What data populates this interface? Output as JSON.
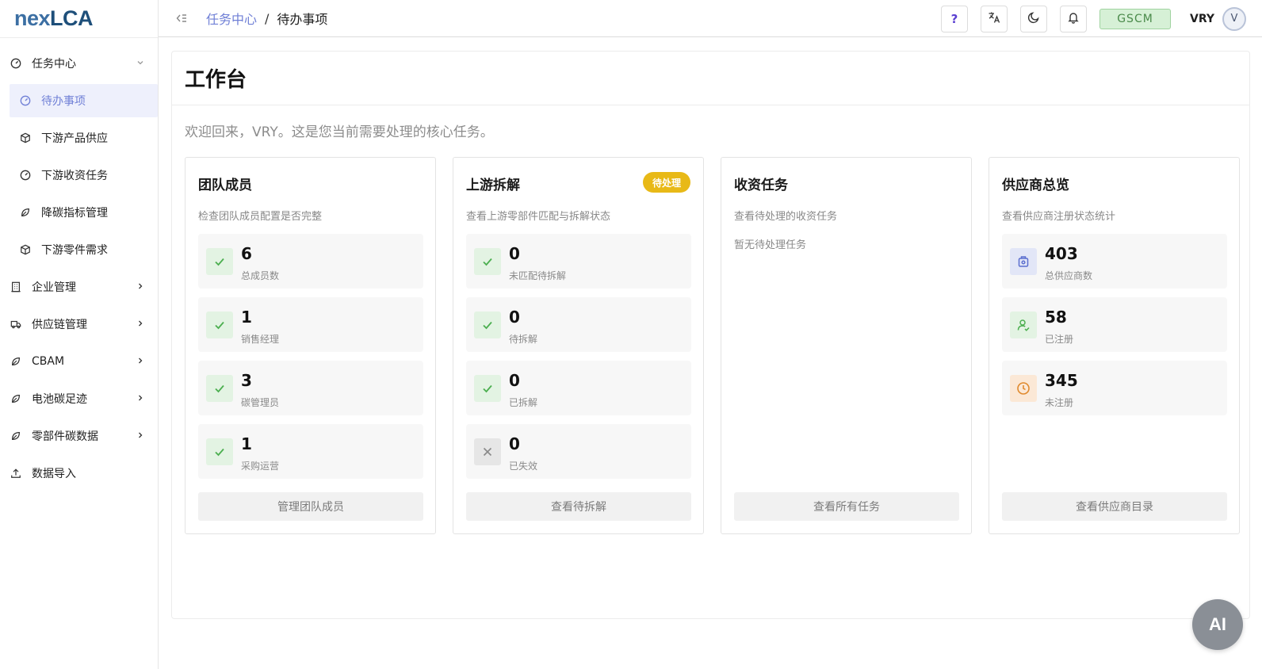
{
  "app": {
    "logo_part1": "nex",
    "logo_part2": "LCA"
  },
  "sidebar": {
    "items": [
      {
        "label": "任务中心",
        "icon": "gauge-icon",
        "expanded": true
      },
      {
        "label": "待办事项",
        "icon": "gauge-icon",
        "active": true
      },
      {
        "label": "下游产品供应",
        "icon": "box-icon"
      },
      {
        "label": "下游收资任务",
        "icon": "gauge-icon"
      },
      {
        "label": "降碳指标管理",
        "icon": "leaf-icon"
      },
      {
        "label": "下游零件需求",
        "icon": "box-icon"
      },
      {
        "label": "企业管理",
        "icon": "building-icon"
      },
      {
        "label": "供应链管理",
        "icon": "truck-icon"
      },
      {
        "label": "CBAM",
        "icon": "leaf-icon"
      },
      {
        "label": "电池碳足迹",
        "icon": "leaf-icon"
      },
      {
        "label": "零部件碳数据",
        "icon": "leaf-icon"
      },
      {
        "label": "数据导入",
        "icon": "upload-icon"
      }
    ]
  },
  "header": {
    "breadcrumb_parent": "任务中心",
    "breadcrumb_sep": "/",
    "breadcrumb_current": "待办事项",
    "help_label": "?",
    "org_tag": "GSCM",
    "user_name": "VRY",
    "avatar_initial": "V"
  },
  "main": {
    "title": "工作台",
    "welcome": "欢迎回来，VRY。这是您当前需要处理的核心任务。",
    "cards": [
      {
        "title": "团队成员",
        "desc": "检查团队成员配置是否完整",
        "stats": [
          {
            "value": "6",
            "label": "总成员数"
          },
          {
            "value": "1",
            "label": "销售经理"
          },
          {
            "value": "3",
            "label": "碳管理员"
          },
          {
            "value": "1",
            "label": "采购运营"
          }
        ],
        "button": "管理团队成员"
      },
      {
        "title": "上游拆解",
        "badge": "待处理",
        "desc": "查看上游零部件匹配与拆解状态",
        "stats": [
          {
            "value": "0",
            "label": "未匹配待拆解"
          },
          {
            "value": "0",
            "label": "待拆解"
          },
          {
            "value": "0",
            "label": "已拆解"
          },
          {
            "value": "0",
            "label": "已失效"
          }
        ],
        "button": "查看待拆解"
      },
      {
        "title": "收资任务",
        "desc": "查看待处理的收资任务",
        "empty": "暂无待处理任务",
        "button": "查看所有任务"
      },
      {
        "title": "供应商总览",
        "desc": "查看供应商注册状态统计",
        "stats": [
          {
            "value": "403",
            "label": "总供应商数"
          },
          {
            "value": "58",
            "label": "已注册"
          },
          {
            "value": "345",
            "label": "未注册"
          }
        ],
        "button": "查看供应商目录"
      }
    ]
  },
  "ai_button": "AI",
  "colors": {
    "accent": "#6f7fd6",
    "badge": "#e8b917",
    "success": "#4caf50",
    "org_tag_bg": "#d6f0d6"
  }
}
